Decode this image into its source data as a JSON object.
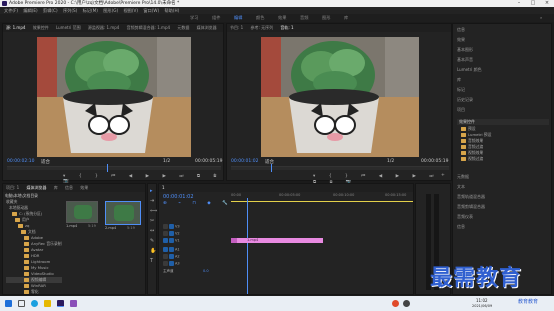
{
  "window": {
    "title": "Adobe Premiere Pro 2020 - C:\\用户\\zq\\文档\\Adobe\\Premiere Pro\\14.0\\未命名 *"
  },
  "menu": [
    "文件(F)",
    "编辑(E)",
    "剪辑(C)",
    "序列(S)",
    "标记(M)",
    "图形(G)",
    "视图(V)",
    "窗口(W)",
    "帮助(H)"
  ],
  "workspaces": {
    "items": [
      "学习",
      "组件",
      "编辑",
      "颜色",
      "效果",
      "音频",
      "图形",
      "库"
    ],
    "active_index": 2
  },
  "source": {
    "tabs": [
      "源: 1.mp4",
      "效果控件",
      "Lumetri 范围",
      "源监视器: 1.mp4",
      "音频剪辑混合器: 1.mp4",
      "元数据",
      "媒体浏览器"
    ],
    "timecode_left": "00:00:02:10",
    "fit": "适合",
    "ratio": "1/2",
    "timecode_right": "00:00:05:19"
  },
  "program": {
    "tabs": [
      "节目: 1",
      "参考: 无序列",
      "音轨: 1"
    ],
    "timecode_left": "00:00:01:02",
    "fit": "适合",
    "ratio": "1/2",
    "timecode_right": "00:00:05:19"
  },
  "project": {
    "tabs": [
      "项目: 1",
      "媒体浏览器",
      "库",
      "信息",
      "效果"
    ],
    "location": "电脑\\本地\\文档目录",
    "tree": [
      "收藏夹",
      "本地驱动器",
      "C: (系统分区)",
      "用户",
      "zq",
      "文档",
      "Adobe",
      "AnyRec 音乐录制",
      "Avatar",
      "HDR",
      "Lightroom",
      "My Music",
      "VideoStudio",
      "视频编辑",
      "WinRAR",
      "零化",
      "VSO 导出",
      "编辑工作"
    ],
    "clips": [
      {
        "name": "1.mp4",
        "duration": "5:19"
      },
      {
        "name": "2.mp4",
        "duration": "5:19"
      }
    ]
  },
  "timeline": {
    "tab": "1",
    "timecode": "00:00:01:02",
    "ruler_labels": [
      "00:00",
      "00:00:05:00",
      "00:00:10:00",
      "00:00:15:00"
    ],
    "tracks": [
      "V3",
      "V2",
      "V1",
      "A1",
      "A2",
      "A3",
      "主声道"
    ],
    "master_value": "0.0",
    "clip_label": "1.mp4"
  },
  "right_panel": {
    "items": [
      "信息",
      "效果",
      "基本图形",
      "基本声音",
      "Lumetri 颜色",
      "库",
      "标记",
      "历史记录",
      "项目"
    ],
    "effects_group": "效果控件",
    "effects_list": [
      "预设",
      "Lumetri 预设",
      "音频效果",
      "音频过渡",
      "视频效果",
      "视频过渡"
    ],
    "bottom_items": [
      "元数据",
      "文本",
      "音频轨道混合器",
      "音频剪辑混合器",
      "音频仪表",
      "信息"
    ]
  },
  "watermark": {
    "text": "最需教育"
  },
  "taskbar": {
    "time": "11:02",
    "date": "2021/06/09",
    "logo_text": "教育教育"
  },
  "colors": {
    "accent": "#4f8ef7",
    "clip": "#e88ae1",
    "panel": "#232323",
    "taskbar": "#e9eef4",
    "watermark": "#2f5fd0"
  }
}
